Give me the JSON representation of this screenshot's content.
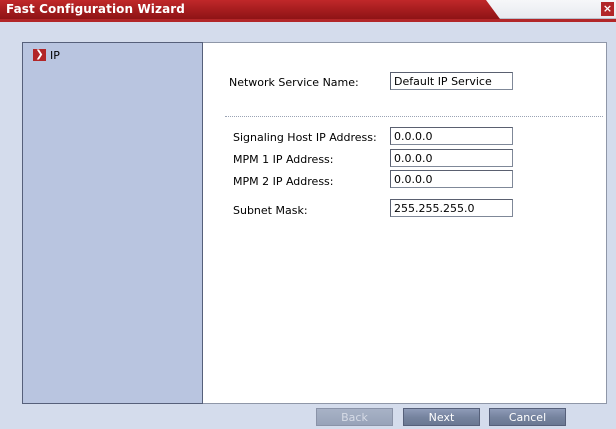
{
  "window": {
    "title": "Fast Configuration Wizard",
    "close_glyph": "×"
  },
  "nav": {
    "items": [
      {
        "label": "IP",
        "selected": true,
        "arrow_glyph": "❯"
      }
    ]
  },
  "form": {
    "network_service_name": {
      "label": "Network Service Name:",
      "value": "Default IP Service"
    },
    "signaling_host_ip": {
      "label": "Signaling Host IP Address:",
      "value": "0.0.0.0"
    },
    "mpm1_ip": {
      "label": "MPM 1 IP Address:",
      "value": "0.0.0.0"
    },
    "mpm2_ip": {
      "label": "MPM 2 IP Address:",
      "value": "0.0.0.0"
    },
    "subnet_mask": {
      "label": "Subnet Mask:",
      "value": "255.255.255.0"
    }
  },
  "buttons": {
    "back": {
      "label": "Back",
      "enabled": false
    },
    "next": {
      "label": "Next",
      "enabled": true
    },
    "cancel": {
      "label": "Cancel",
      "enabled": true
    }
  },
  "colors": {
    "title_red": "#b22628",
    "nav_bg": "#b9c5e0",
    "window_bg": "#d4dcec",
    "button_bg": "#76849f"
  }
}
